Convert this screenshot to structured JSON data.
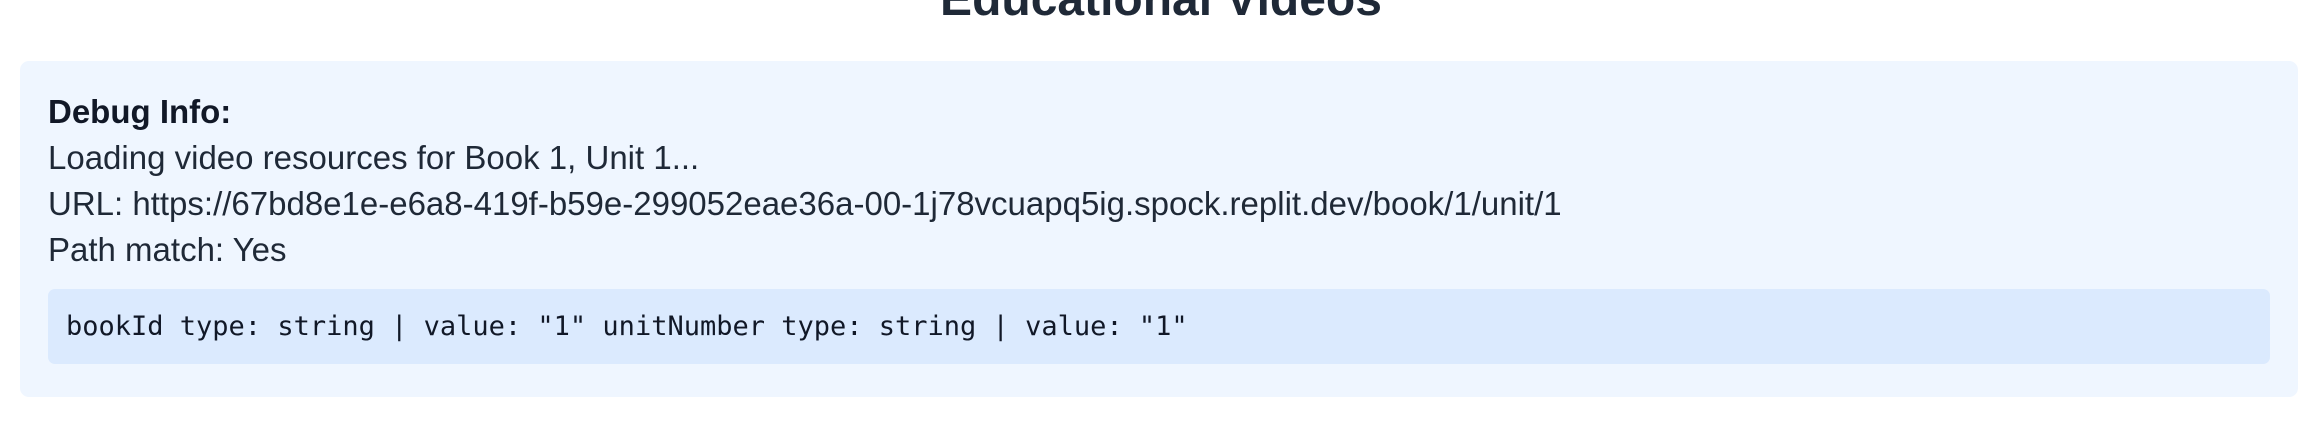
{
  "page": {
    "title": "Educational Videos"
  },
  "debug": {
    "heading": "Debug Info:",
    "loading_text": "Loading video resources for Book 1, Unit 1...",
    "url_line": "URL: https://67bd8e1e-e6a8-419f-b59e-299052eae36a-00-1j78vcuapq5ig.spock.replit.dev/book/1/unit/1",
    "path_match_line": "Path match: Yes",
    "code_line": "bookId type: string | value: \"1\" unitNumber type: string | value: \"1\""
  },
  "colors": {
    "panel_background": "#eff6ff",
    "code_background": "#dbeafe",
    "text": "#1f2937"
  }
}
